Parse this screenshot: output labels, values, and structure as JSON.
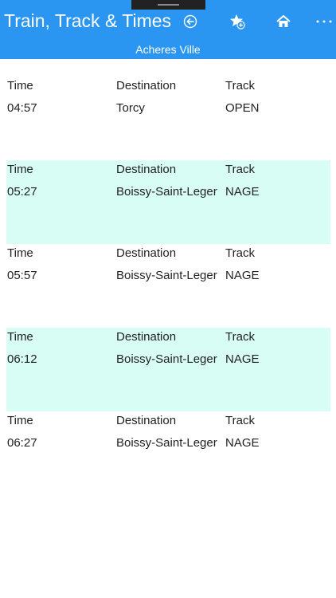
{
  "app": {
    "title": "Train, Track & Times",
    "station": "Acheres Ville"
  },
  "toolbar": {
    "icons": [
      "back-circle-icon",
      "favorite-add-icon",
      "home-icon",
      "more-icon"
    ]
  },
  "columns": {
    "time": "Time",
    "destination": "Destination",
    "track": "Track"
  },
  "departures": [
    {
      "time": "04:57",
      "destination": "Torcy",
      "track": "OPEN"
    },
    {
      "time": "05:27",
      "destination": "Boissy-Saint-Leger",
      "track": "NAGE"
    },
    {
      "time": "05:57",
      "destination": "Boissy-Saint-Leger",
      "track": "NAGE"
    },
    {
      "time": "06:12",
      "destination": "Boissy-Saint-Leger",
      "track": "NAGE"
    },
    {
      "time": "06:27",
      "destination": "Boissy-Saint-Leger",
      "track": "NAGE"
    }
  ],
  "colors": {
    "app_bar": "#2b96f2",
    "alt_row": "#d8fdf5"
  }
}
